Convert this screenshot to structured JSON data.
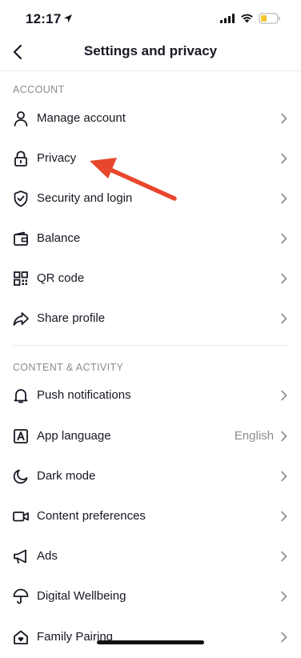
{
  "status_bar": {
    "time": "12:17"
  },
  "nav": {
    "title": "Settings and privacy"
  },
  "sections": {
    "account": {
      "header": "ACCOUNT",
      "items": [
        {
          "label": "Manage account",
          "icon": "person-icon"
        },
        {
          "label": "Privacy",
          "icon": "lock-icon"
        },
        {
          "label": "Security and login",
          "icon": "shield-icon"
        },
        {
          "label": "Balance",
          "icon": "wallet-icon"
        },
        {
          "label": "QR code",
          "icon": "qr-code-icon"
        },
        {
          "label": "Share profile",
          "icon": "share-icon"
        }
      ]
    },
    "content": {
      "header": "CONTENT & ACTIVITY",
      "items": [
        {
          "label": "Push notifications",
          "icon": "bell-icon"
        },
        {
          "label": "App language",
          "icon": "language-icon",
          "value": "English"
        },
        {
          "label": "Dark mode",
          "icon": "moon-icon"
        },
        {
          "label": "Content preferences",
          "icon": "video-icon"
        },
        {
          "label": "Ads",
          "icon": "megaphone-icon"
        },
        {
          "label": "Digital Wellbeing",
          "icon": "umbrella-icon"
        },
        {
          "label": "Family Pairing",
          "icon": "house-icon"
        }
      ]
    }
  },
  "colors": {
    "annotation_arrow": "#e8472d",
    "text": "#161823",
    "muted": "#8a8b91"
  }
}
